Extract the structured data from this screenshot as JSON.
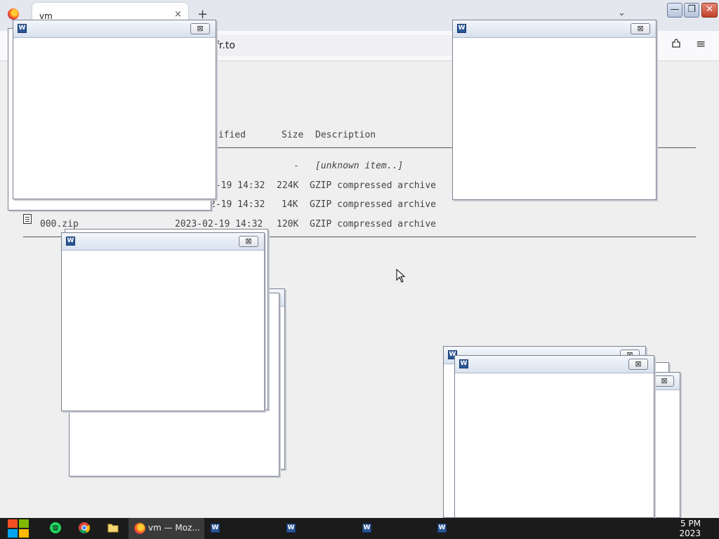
{
  "browser": {
    "tab_title": "vm",
    "tab_close": "×",
    "new_tab": "+",
    "tab_list": "⌄",
    "url": "fr.to",
    "win_minimize": "—",
    "win_maximize": "❐",
    "win_close": "✕",
    "menu": "≡"
  },
  "listing": {
    "headers": {
      "modified": "dified",
      "size": "Size",
      "description": "Description"
    },
    "rows": [
      {
        "date": "",
        "size": "-",
        "description": "[unknown item..]"
      },
      {
        "date": "2-19 14:32",
        "size": "224K",
        "description": "GZIP compressed archive"
      },
      {
        "date": "2-19 14:32",
        "size": "14K",
        "description": "GZIP compressed archive"
      },
      {
        "name": "000.zip",
        "date": "2023-02-19 14:32",
        "size": "120K",
        "description": "GZIP compressed archive"
      }
    ]
  },
  "popups": {
    "word_icon": "W",
    "close_glyph": "⊠"
  },
  "taskbar": {
    "firefox_label": "vm — Moz...",
    "clock_time": "5 PM",
    "clock_date": "2023"
  },
  "colors": {
    "taskbar_bg": "#1b1b1b",
    "popup_title_gradient_top": "#f4f7fb",
    "popup_title_gradient_bottom": "#d7e1ee",
    "word_blue": "#2b5797",
    "close_red": "#c2402a"
  }
}
